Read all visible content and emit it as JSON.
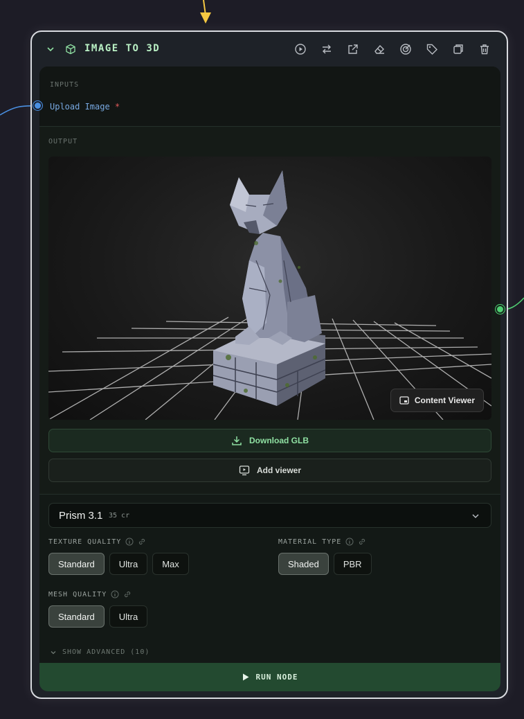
{
  "node": {
    "title": "IMAGE TO 3D",
    "header_icons": [
      "play-icon",
      "swap-icon",
      "external-link-icon",
      "eraser-icon",
      "target-icon",
      "tag-icon",
      "duplicate-icon",
      "trash-icon"
    ]
  },
  "inputs": {
    "section_label": "INPUTS",
    "upload_label": "Upload Image",
    "required_marker": "*"
  },
  "output": {
    "section_label": "OUTPUT",
    "content_viewer_label": "Content Viewer",
    "download_label": "Download GLB",
    "add_viewer_label": "Add viewer"
  },
  "settings": {
    "model_name": "Prism 3.1",
    "model_cost": "35 cr",
    "texture_quality": {
      "label": "TEXTURE QUALITY",
      "options": [
        "Standard",
        "Ultra",
        "Max"
      ],
      "selected": "Standard"
    },
    "material_type": {
      "label": "MATERIAL TYPE",
      "options": [
        "Shaded",
        "PBR"
      ],
      "selected": "Shaded"
    },
    "mesh_quality": {
      "label": "MESH QUALITY",
      "options": [
        "Standard",
        "Ultra"
      ],
      "selected": "Standard"
    },
    "show_advanced": "SHOW ADVANCED (10)"
  },
  "run_label": "RUN NODE",
  "colors": {
    "accent_green": "#4fcf72",
    "input_port_blue": "#4a90e2",
    "run_bar": "#234a30",
    "arrow_yellow": "#f5c842"
  }
}
